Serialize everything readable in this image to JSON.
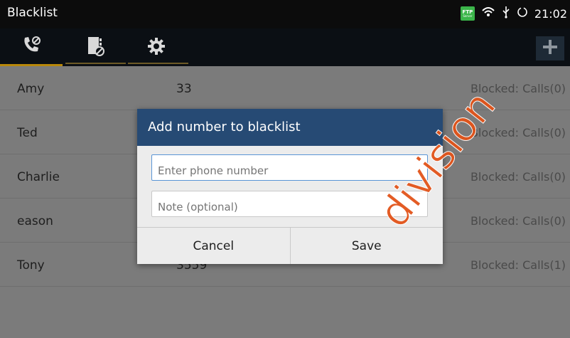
{
  "statusbar": {
    "title": "Blacklist",
    "ftp_label": "FTP",
    "ftp_sub": "Server",
    "time": "21:02"
  },
  "toolbar": {
    "tabs": [
      {
        "icon": "phone-block-icon",
        "active": true
      },
      {
        "icon": "contact-block-icon",
        "active": false
      },
      {
        "icon": "gear-icon",
        "active": false
      }
    ],
    "add_icon": "plus-icon"
  },
  "list": [
    {
      "name": "Amy",
      "number": "33",
      "status": "Blocked: Calls(0)"
    },
    {
      "name": "Ted",
      "number": "",
      "status": "Blocked: Calls(0)"
    },
    {
      "name": "Charlie",
      "number": "",
      "status": "Blocked: Calls(0)"
    },
    {
      "name": "eason",
      "number": "",
      "status": "Blocked: Calls(0)"
    },
    {
      "name": "Tony",
      "number": "3559",
      "status": "Blocked: Calls(1)"
    }
  ],
  "dialog": {
    "title": "Add number to blacklist",
    "phone_placeholder": "Enter phone number",
    "note_placeholder": "Note (optional)",
    "cancel_label": "Cancel",
    "save_label": "Save"
  },
  "watermark": {
    "text": "division",
    "color": "#e2541a"
  },
  "colors": {
    "header_blue": "#264a74",
    "accent_gold": "#b8870a",
    "ftp_green": "#3bb54a"
  }
}
